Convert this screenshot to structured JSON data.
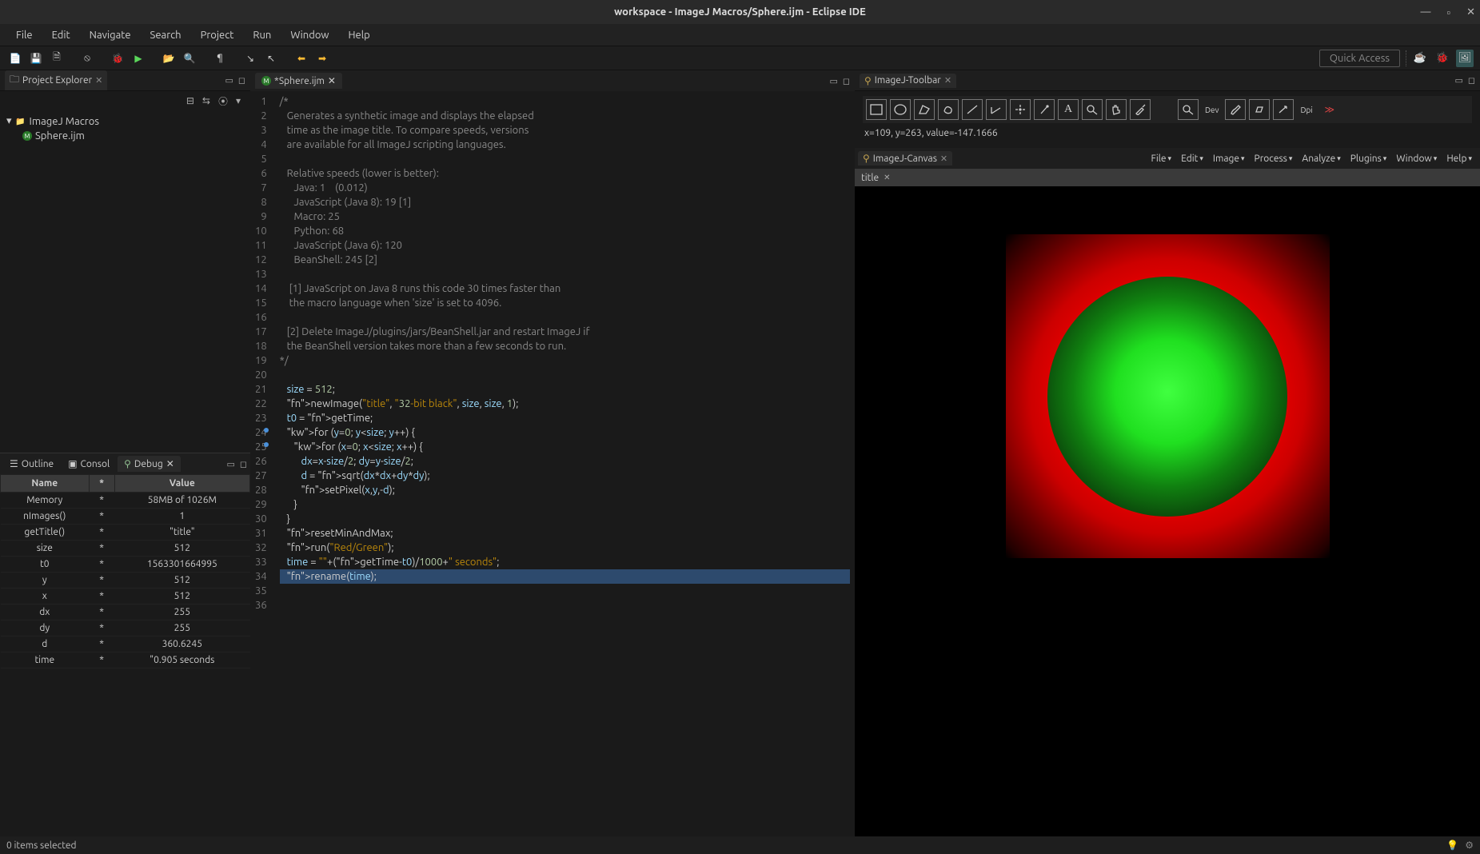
{
  "window": {
    "title": "workspace - ImageJ Macros/Sphere.ijm - Eclipse IDE",
    "quickAccess": "Quick Access"
  },
  "menus": [
    "File",
    "Edit",
    "Navigate",
    "Search",
    "Project",
    "Run",
    "Window",
    "Help"
  ],
  "projectExplorer": {
    "title": "Project Explorer",
    "root": "ImageJ Macros",
    "child": "Sphere.ijm"
  },
  "editor": {
    "tab": "*Sphere.ijm",
    "lines": [
      "/*",
      "   Generates a synthetic image and displays the elapsed",
      "   time as the image title. To compare speeds, versions",
      "   are available for all ImageJ scripting languages.",
      "",
      "   Relative speeds (lower is better):",
      "      Java: 1    (0.012)",
      "      JavaScript (Java 8): 19 [1]",
      "      Macro: 25",
      "      Python: 68",
      "      JavaScript (Java 6): 120",
      "      BeanShell: 245 [2]",
      "",
      "    [1] JavaScript on Java 8 runs this code 30 times faster than",
      "    the macro language when 'size' is set to 4096.",
      "",
      "   [2] Delete ImageJ/plugins/jars/BeanShell.jar and restart ImageJ if",
      "   the BeanShell version takes more than a few seconds to run.",
      "*/",
      "",
      "   size = 512;",
      "   newImage(\"title\", \"32-bit black\", size, size, 1);",
      "   t0 = getTime;",
      "   for (y=0; y<size; y++) {",
      "      for (x=0; x<size; x++) {",
      "         dx=x-size/2; dy=y-size/2;",
      "         d = sqrt(dx*dx+dy*dy);",
      "         setPixel(x,y,-d);",
      "      }",
      "   }",
      "   resetMinAndMax;",
      "   run(\"Red/Green\");",
      "   time = \"\"+(getTime-t0)/1000+\" seconds\";",
      "   rename(time);",
      "",
      ""
    ]
  },
  "debugView": {
    "tabs": [
      "Outline",
      "Consol",
      "Debug"
    ],
    "columns": [
      "Name",
      "*",
      "Value"
    ],
    "rows": [
      {
        "name": "Memory",
        "star": "*",
        "value": "58MB of 1026M"
      },
      {
        "name": "nImages()",
        "star": "*",
        "value": "1"
      },
      {
        "name": "getTitle()",
        "star": "*",
        "value": "\"title\""
      },
      {
        "name": "size",
        "star": "*",
        "value": "512"
      },
      {
        "name": "t0",
        "star": "*",
        "value": "1563301664995"
      },
      {
        "name": "y",
        "star": "*",
        "value": "512"
      },
      {
        "name": "x",
        "star": "*",
        "value": "512"
      },
      {
        "name": "dx",
        "star": "*",
        "value": "255"
      },
      {
        "name": "dy",
        "star": "*",
        "value": "255"
      },
      {
        "name": "d",
        "star": "*",
        "value": "360.6245"
      },
      {
        "name": "time",
        "star": "*",
        "value": "\"0.905 seconds"
      }
    ]
  },
  "imagej": {
    "toolbarTitle": "ImageJ-Toolbar",
    "canvasTitle": "ImageJ-Canvas",
    "status": "x=109, y=263, value=-147.1666",
    "canvasTabLabel": "title",
    "menus": [
      "File",
      "Edit",
      "Image",
      "Process",
      "Analyze",
      "Plugins",
      "Window",
      "Help"
    ]
  },
  "statusbar": {
    "left": "0 items selected"
  }
}
